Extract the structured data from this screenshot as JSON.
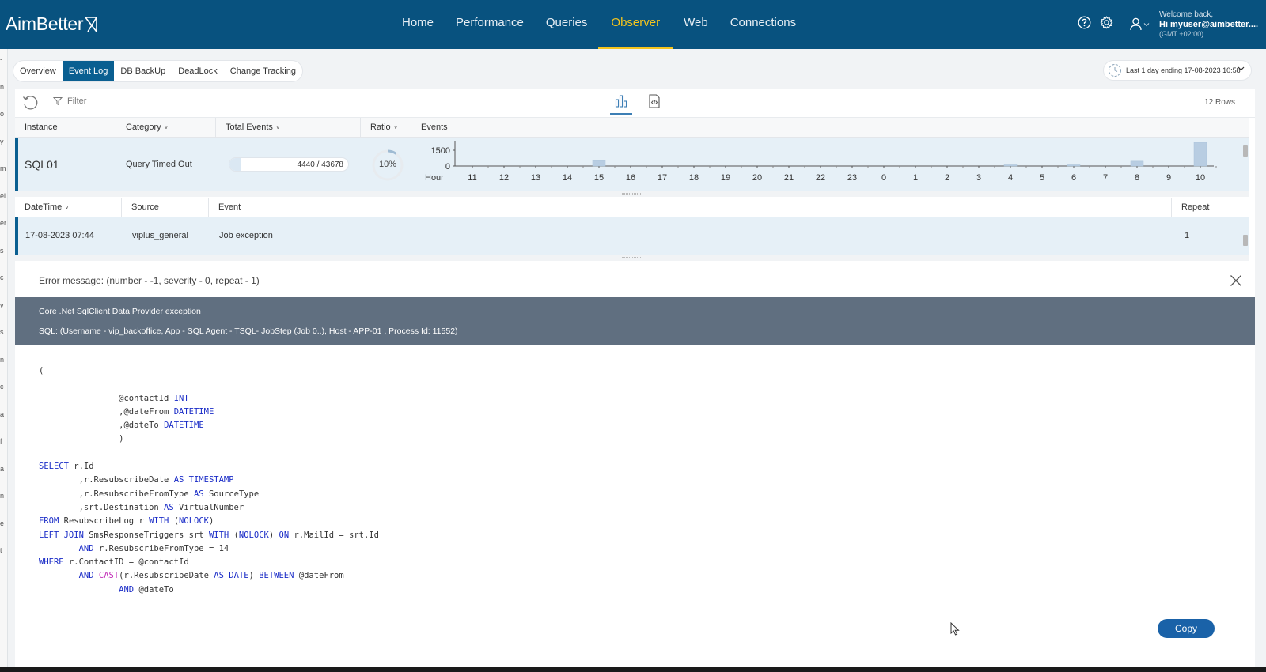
{
  "brand": {
    "name": "AimBetter"
  },
  "nav": {
    "items": [
      {
        "label": "Home",
        "active": false
      },
      {
        "label": "Performance",
        "active": false
      },
      {
        "label": "Queries",
        "active": false
      },
      {
        "label": "Observer",
        "active": true
      },
      {
        "label": "Web",
        "active": false
      },
      {
        "label": "Connections",
        "active": false
      }
    ],
    "accent_color": "#f5c51d",
    "bar_color": "#08527f"
  },
  "header_icons": [
    "help-icon",
    "gear-icon",
    "user-icon"
  ],
  "user": {
    "welcome": "Welcome back,",
    "greeting": "Hi myuser@aimbetter....",
    "timezone": "(GMT +02:00)"
  },
  "subtabs": [
    {
      "label": "Overview",
      "active": false
    },
    {
      "label": "Event Log",
      "active": true
    },
    {
      "label": "DB BackUp",
      "active": false
    },
    {
      "label": "DeadLock",
      "active": false
    },
    {
      "label": "Change Tracking",
      "active": false
    }
  ],
  "time_range": {
    "label": "Last 1 day ending  17-08-2023 10:58"
  },
  "toolbar": {
    "filter_label": "Filter",
    "rows_label": "12 Rows"
  },
  "main_table": {
    "columns": [
      {
        "label": "Instance",
        "sortable": false
      },
      {
        "label": "Category",
        "sortable": true
      },
      {
        "label": "Total Events",
        "sortable": true
      },
      {
        "label": "Ratio",
        "sortable": true
      },
      {
        "label": "Events",
        "sortable": false
      }
    ],
    "row": {
      "instance": "SQL01",
      "category": "Query Timed Out",
      "total_events": "4440 / 43678",
      "total_fraction": 0.102,
      "ratio": "10%",
      "ratio_fraction": 0.1
    }
  },
  "chart_data": {
    "type": "bar",
    "xlabel": "Hour",
    "categories": [
      "11",
      "12",
      "13",
      "14",
      "15",
      "16",
      "17",
      "18",
      "19",
      "20",
      "21",
      "22",
      "23",
      "0",
      "1",
      "2",
      "3",
      "4",
      "5",
      "6",
      "7",
      "8",
      "9",
      "10"
    ],
    "values": [
      0,
      0,
      0,
      0,
      520,
      0,
      0,
      0,
      0,
      0,
      0,
      0,
      0,
      0,
      0,
      0,
      0,
      60,
      0,
      60,
      0,
      460,
      0,
      2250
    ],
    "yticks": [
      "1500",
      "0"
    ],
    "ylim": [
      0,
      2400
    ],
    "bar_color": "#b8cde2"
  },
  "detail_table": {
    "columns": [
      {
        "label": "DateTime",
        "sortable": true
      },
      {
        "label": "Source",
        "sortable": false
      },
      {
        "label": "Event",
        "sortable": false
      },
      {
        "label": "Repeat",
        "sortable": false
      }
    ],
    "row": {
      "datetime": "17-08-2023 07:44",
      "source": "viplus_general",
      "event": "Job exception",
      "repeat": "1"
    }
  },
  "error": {
    "title": "Error message: (number - -1, severity - 0, repeat - 1)",
    "line1": "Core .Net SqlClient Data Provider exception",
    "line2": "SQL: (Username - vip_backoffice, App - SQL Agent - TSQL- JobStep (Job 0..), Host - APP-01 , Process Id: 11552)"
  },
  "code_lines": [
    [
      {
        "t": "("
      }
    ],
    [
      {
        "t": ""
      }
    ],
    [
      {
        "t": "\t\t@contactId "
      },
      {
        "t": "INT",
        "k": "kw"
      }
    ],
    [
      {
        "t": "\t\t,@dateFrom "
      },
      {
        "t": "DATETIME",
        "k": "kw"
      }
    ],
    [
      {
        "t": "\t\t,@dateTo "
      },
      {
        "t": "DATETIME",
        "k": "kw"
      }
    ],
    [
      {
        "t": "\t\t)"
      }
    ],
    [
      {
        "t": ""
      }
    ],
    [
      {
        "t": "SELECT",
        "k": "kw"
      },
      {
        "t": " r.Id"
      }
    ],
    [
      {
        "t": "\t,r.ResubscribeDate "
      },
      {
        "t": "AS TIMESTAMP",
        "k": "kw"
      }
    ],
    [
      {
        "t": "\t,r.ResubscribeFromType "
      },
      {
        "t": "AS",
        "k": "kw"
      },
      {
        "t": " SourceType"
      }
    ],
    [
      {
        "t": "\t,srt.Destination "
      },
      {
        "t": "AS",
        "k": "kw"
      },
      {
        "t": " VirtualNumber"
      }
    ],
    [
      {
        "t": "FROM",
        "k": "kw"
      },
      {
        "t": " ResubscribeLog r "
      },
      {
        "t": "WITH",
        "k": "kw"
      },
      {
        "t": " ("
      },
      {
        "t": "NOLOCK",
        "k": "kw"
      },
      {
        "t": ")"
      }
    ],
    [
      {
        "t": "LEFT JOIN",
        "k": "kw"
      },
      {
        "t": " SmsResponseTriggers srt "
      },
      {
        "t": "WITH",
        "k": "kw"
      },
      {
        "t": " ("
      },
      {
        "t": "NOLOCK",
        "k": "kw"
      },
      {
        "t": ") "
      },
      {
        "t": "ON",
        "k": "kw"
      },
      {
        "t": " r.MailId = srt.Id"
      }
    ],
    [
      {
        "t": "\t"
      },
      {
        "t": "AND",
        "k": "kw"
      },
      {
        "t": " r.ResubscribeFromType = 14"
      }
    ],
    [
      {
        "t": "WHERE",
        "k": "kw"
      },
      {
        "t": " r.ContactID = @contactId"
      }
    ],
    [
      {
        "t": "\t"
      },
      {
        "t": "AND",
        "k": "kw"
      },
      {
        "t": " "
      },
      {
        "t": "CAST",
        "k": "fn"
      },
      {
        "t": "(r.ResubscribeDate "
      },
      {
        "t": "AS DATE",
        "k": "kw"
      },
      {
        "t": ") "
      },
      {
        "t": "BETWEEN",
        "k": "kw"
      },
      {
        "t": " @dateFrom"
      }
    ],
    [
      {
        "t": "\t\t"
      },
      {
        "t": "AND",
        "k": "kw"
      },
      {
        "t": " @dateTo"
      }
    ]
  ],
  "copy_label": "Copy",
  "left_strip_chars": [
    "-",
    "n",
    "o",
    "y",
    "m",
    "ei",
    "er",
    "s",
    "c",
    "v",
    "s",
    "n",
    "c",
    "a",
    "f",
    "a",
    "n",
    "e",
    "t"
  ]
}
